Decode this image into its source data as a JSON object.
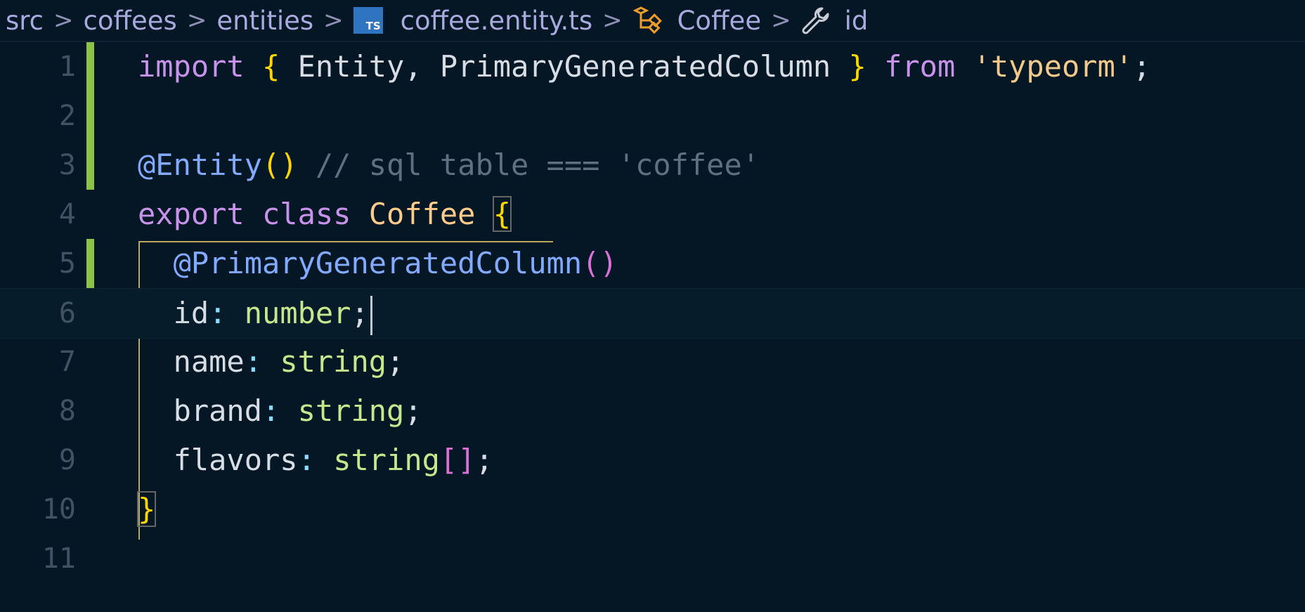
{
  "breadcrumb": {
    "items": [
      "src",
      "coffees",
      "entities",
      "coffee.entity.ts",
      "Coffee",
      "id"
    ],
    "separator": ">",
    "ts_badge": "TS"
  },
  "editor": {
    "lines": [
      {
        "n": "1"
      },
      {
        "n": "2"
      },
      {
        "n": "3"
      },
      {
        "n": "4"
      },
      {
        "n": "5"
      },
      {
        "n": "6"
      },
      {
        "n": "7"
      },
      {
        "n": "8"
      },
      {
        "n": "9"
      },
      {
        "n": "10"
      },
      {
        "n": "11"
      }
    ],
    "tokens": {
      "l1": [
        "import",
        "{",
        "Entity,",
        "PrimaryGeneratedColumn",
        "}",
        "from",
        "'typeorm'",
        ";"
      ],
      "l3": [
        "@Entity",
        "()",
        "// sql table === 'coffee'"
      ],
      "l4": [
        "export",
        "class",
        "Coffee",
        "{"
      ],
      "l5": [
        "@PrimaryGeneratedColumn",
        "()"
      ],
      "l6": [
        "id",
        ":",
        "number",
        ";"
      ],
      "l7": [
        "name",
        ":",
        "string",
        ";"
      ],
      "l8": [
        "brand",
        ":",
        "string",
        ";"
      ],
      "l9": [
        "flavors",
        ":",
        "string",
        "[]",
        ";"
      ],
      "l10": [
        "}"
      ]
    },
    "current_line": 6
  },
  "colors": {
    "background": "#051624",
    "keyword": "#c792ea",
    "bracket": "#ffd700",
    "string": "#f1c98a",
    "decorator": "#82aaff",
    "comment": "#5f7180",
    "type": "#c3e88d",
    "gutter_modified": "#8bc34a"
  },
  "icons": {
    "file": "typescript-file-icon",
    "class": "class-symbol-icon",
    "property": "wrench-property-icon"
  }
}
